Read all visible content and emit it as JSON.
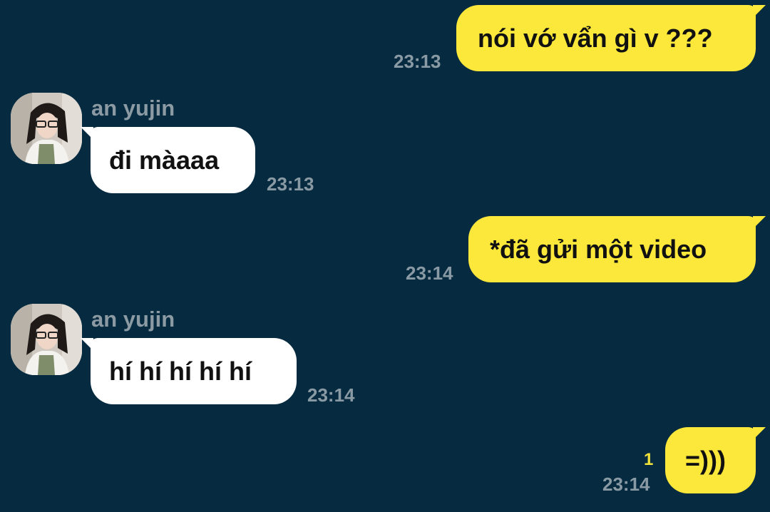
{
  "messages": [
    {
      "direction": "outgoing",
      "text": "nói vớ vẩn gì v ???",
      "time": "23:13"
    },
    {
      "direction": "incoming",
      "sender": "an yujin",
      "text": "đi màaaa",
      "time": "23:13"
    },
    {
      "direction": "outgoing",
      "text": "*đã gửi một video",
      "time": "23:14"
    },
    {
      "direction": "incoming",
      "sender": "an yujin",
      "text": "hí hí hí hí hí",
      "time": "23:14"
    },
    {
      "direction": "outgoing",
      "text": "=)))",
      "time": "23:14",
      "unread_count": "1"
    }
  ],
  "colors": {
    "background": "#062b40",
    "outgoing_bubble": "#fbe83a",
    "incoming_bubble": "#ffffff",
    "timestamp": "#8a9aa4",
    "unread_indicator": "#f0e23a"
  },
  "icons": {
    "avatar": "profile-photo"
  }
}
